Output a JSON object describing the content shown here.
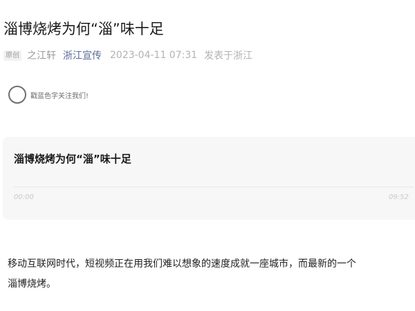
{
  "article": {
    "title": "淄博烧烤为何“淄”味十足"
  },
  "meta": {
    "original_tag": "原创",
    "author": "之江轩",
    "account": "浙江宣传",
    "publish_time": "2023-04-11 07:31",
    "location": "发表于浙江"
  },
  "follow": {
    "text": "戳蓝色字关注我们!"
  },
  "audio": {
    "title": "淄博烧烤为何“淄”味十足",
    "current_time": "00:00",
    "total_time": "09:52",
    "progress": 0
  },
  "body": {
    "line1": "移动互联网时代，短视频正在用我们难以想象的速度成就一座城市，而最新的一个",
    "line2": "淄博烧烤。"
  },
  "colors": {
    "link": "#576b95",
    "muted": "#b2b2b2",
    "card_background": "#f7f7f7"
  }
}
